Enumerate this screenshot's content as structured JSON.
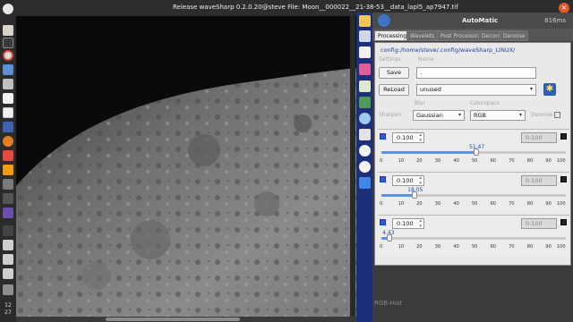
{
  "window": {
    "title": "Release waveSharp 0.2.0.20@steve    File: Moon__000022__21-38-53__data_lapl5_ap7947.tif",
    "close_label": "×"
  },
  "clock": {
    "hour": "12",
    "minute": "27"
  },
  "panel": {
    "title": "AutoMatic",
    "value": "816ms",
    "tabs": [
      "Processing",
      "Wavelets",
      "Post Processing",
      "Deconv",
      "Denoise"
    ],
    "config_path": "config:/home/steve/.config/waveSharp_LINUX/",
    "settings_label": "Settings",
    "name_label": "Name",
    "save_button": "Save",
    "reload_button": "ReLoad",
    "name_value": ".",
    "preset_value": "unused",
    "blur_label": "Blur",
    "colorspace_label": "Colorspace",
    "sharpen_label": "Sharpen",
    "blur_value": "Gaussian",
    "colorspace_value": "RGB",
    "denoise_label": "Denoise",
    "rgb_hist_label": "RGB-Hist"
  },
  "sliders": [
    {
      "left_value": "0.100",
      "right_value": "0.100",
      "level": 51.47,
      "level_label": "51.47"
    },
    {
      "left_value": "0.100",
      "right_value": "0.100",
      "level": 18.05,
      "level_label": "18.05"
    },
    {
      "left_value": "0.100",
      "right_value": "0.100",
      "level": 4.43,
      "level_label": "4.43"
    }
  ],
  "ticks": [
    "0",
    "10",
    "20",
    "30",
    "40",
    "50",
    "60",
    "70",
    "80",
    "90",
    "100"
  ],
  "icons": {
    "launcher": [
      "ubuntu-logo-icon",
      "files-icon",
      "terminal-icon",
      "chrome-icon",
      "settings-icon",
      "text-editor-icon",
      "document-icon",
      "software-icon",
      "help-icon",
      "firefox-icon",
      "calendar-icon",
      "photo-icon",
      "app-icon",
      "app-icon",
      "app-icon",
      "trash-icon"
    ],
    "toolbar": [
      "folder-open-icon",
      "refresh-icon",
      "save-icon",
      "document-icon",
      "color-icon",
      "histogram-icon",
      "align-icon",
      "zoom-icon",
      "layers-icon",
      "circle-icon",
      "pen-icon",
      "move-icon"
    ]
  },
  "colors": {
    "accent": "#2b5bd7",
    "toolbar": "#1e2f7a",
    "value_text": "#1f4fae"
  }
}
